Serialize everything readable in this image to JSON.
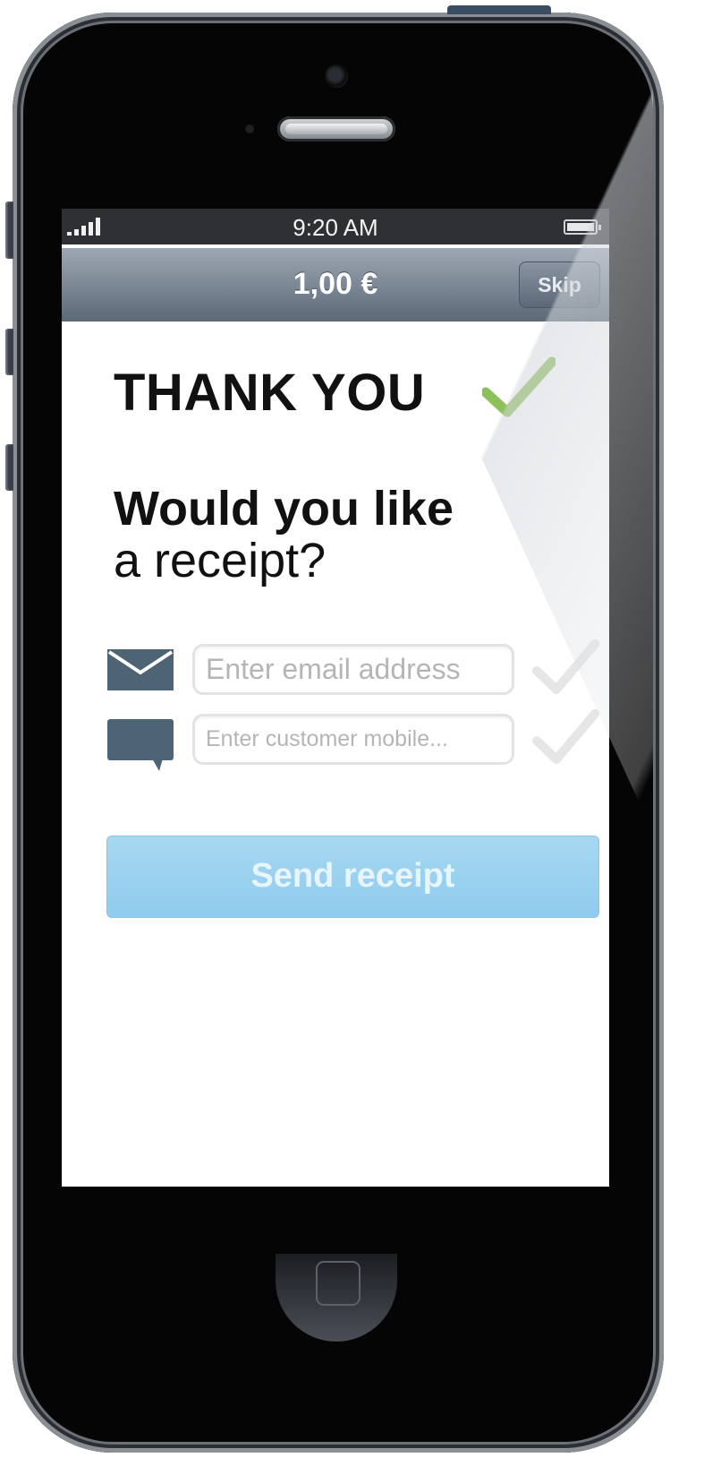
{
  "status_bar": {
    "time": "9:20 AM",
    "signal_icon": "signal-bars-icon",
    "battery_icon": "battery-icon"
  },
  "nav": {
    "amount": "1,00 €",
    "skip_label": "Skip"
  },
  "content": {
    "thank_you": "THANK YOU",
    "success_icon": "checkmark-icon",
    "question_bold": "Would you like",
    "question_rest": "a receipt?"
  },
  "form": {
    "email_icon": "envelope-icon",
    "email_placeholder": "Enter email address",
    "mobile_icon": "chat-bubble-icon",
    "mobile_placeholder": "Enter customer mobile...",
    "send_label": "Send receipt"
  },
  "colors": {
    "success_green": "#8cc15a",
    "icon_slate": "#4d6475",
    "button_blue": "#9dd3f0",
    "navbar_top": "#9ea8b4",
    "navbar_bottom": "#5b6876"
  }
}
